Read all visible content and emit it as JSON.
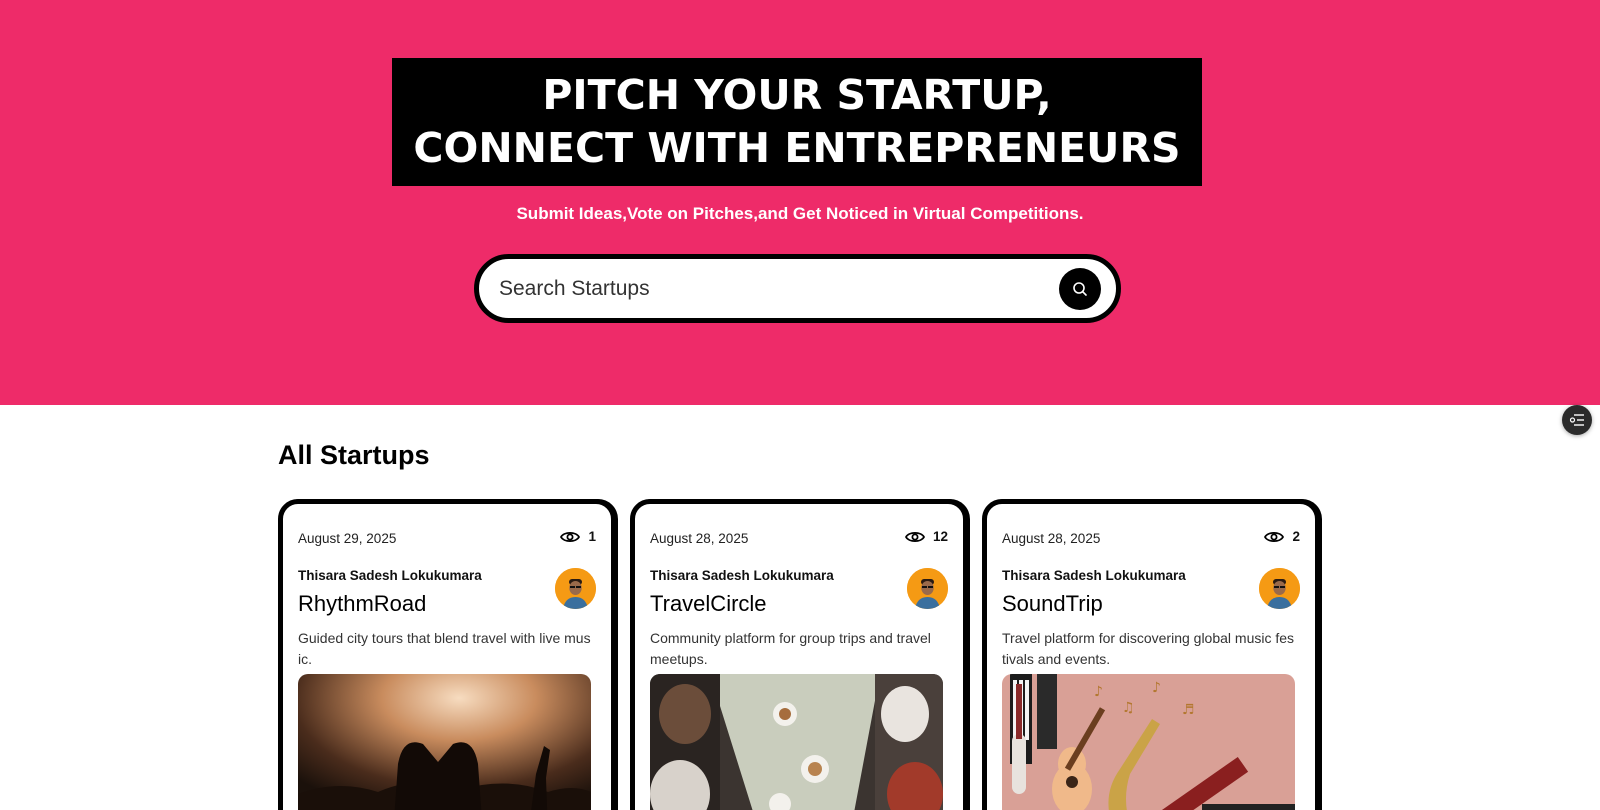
{
  "hero": {
    "title_line1": "PITCH YOUR STARTUP,",
    "title_line2": "CONNECT WITH ENTREPRENEURS",
    "subtitle": "Submit Ideas,Vote on Pitches,and Get Noticed in Virtual Competitions.",
    "background_color": "#ee2b69"
  },
  "search": {
    "placeholder": "Search Startups",
    "button_icon": "search-icon"
  },
  "floating_button": {
    "icon": "filter-list-icon"
  },
  "section": {
    "title": "All Startups"
  },
  "startups": [
    {
      "date": "August 29, 2025",
      "views": "1",
      "author": "Thisara Sadesh Lokukumara",
      "title": "RhythmRoad",
      "description": "Guided city tours that blend travel with live music.",
      "image": "concert-crowd-image"
    },
    {
      "date": "August 28, 2025",
      "views": "12",
      "author": "Thisara Sadesh Lokukumara",
      "title": "TravelCircle",
      "description": "Community platform for group trips and travel meetups.",
      "image": "group-dining-image"
    },
    {
      "date": "August 28, 2025",
      "views": "2",
      "author": "Thisara Sadesh Lokukumara",
      "title": "SoundTrip",
      "description": "Travel platform for discovering global music festivals and events.",
      "image": "music-instruments-image"
    }
  ]
}
